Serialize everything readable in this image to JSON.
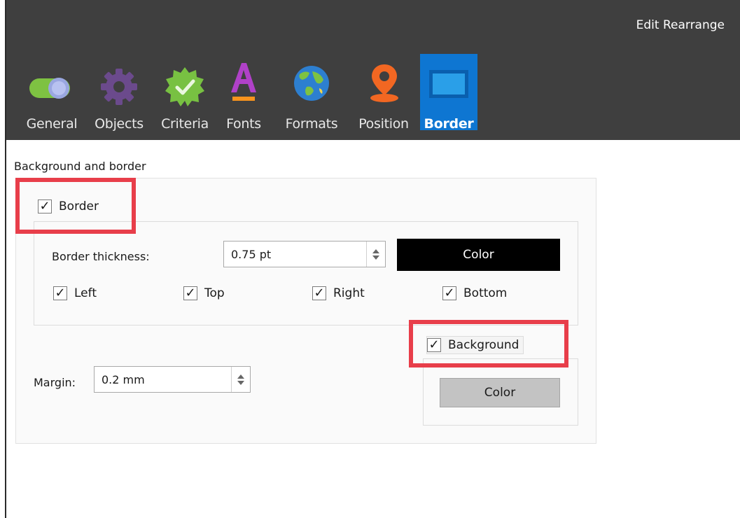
{
  "header": {
    "top_actions": "Edit Rearrange",
    "tabs": [
      {
        "label": "General",
        "icon": "toggle-icon",
        "color": "#7ec242"
      },
      {
        "label": "Objects",
        "icon": "gear-icon",
        "color": "#6b4a8c"
      },
      {
        "label": "Criteria",
        "icon": "badge-check-icon",
        "color": "#78c142"
      },
      {
        "label": "Fonts",
        "icon": "font-a-icon",
        "color": "#b041c8"
      },
      {
        "label": "Formats",
        "icon": "globe-icon",
        "color": "#2d7fd0"
      },
      {
        "label": "Position",
        "icon": "map-pin-icon",
        "color": "#f26722"
      },
      {
        "label": "Border",
        "icon": "border-frame-icon",
        "color": "#0e76d2",
        "active": true
      }
    ]
  },
  "panel": {
    "title": "Background and border",
    "border": {
      "checkbox_label": "Border",
      "checked": true,
      "thickness_label": "Border thickness:",
      "thickness_value": "0.75 pt",
      "color_button": "Color",
      "color_button_bg": "#000000",
      "sides": [
        {
          "label": "Left",
          "checked": true
        },
        {
          "label": "Top",
          "checked": true
        },
        {
          "label": "Right",
          "checked": true
        },
        {
          "label": "Bottom",
          "checked": true
        }
      ]
    },
    "background": {
      "checkbox_label": "Background",
      "checked": true,
      "color_button": "Color",
      "color_button_bg": "#c3c3c3"
    },
    "margin": {
      "label": "Margin:",
      "value": "0.2 mm"
    }
  },
  "colors": {
    "highlight": "#e83e4a",
    "toolbar_bg": "#3f3f3f",
    "active_tab": "#0e76d2"
  }
}
